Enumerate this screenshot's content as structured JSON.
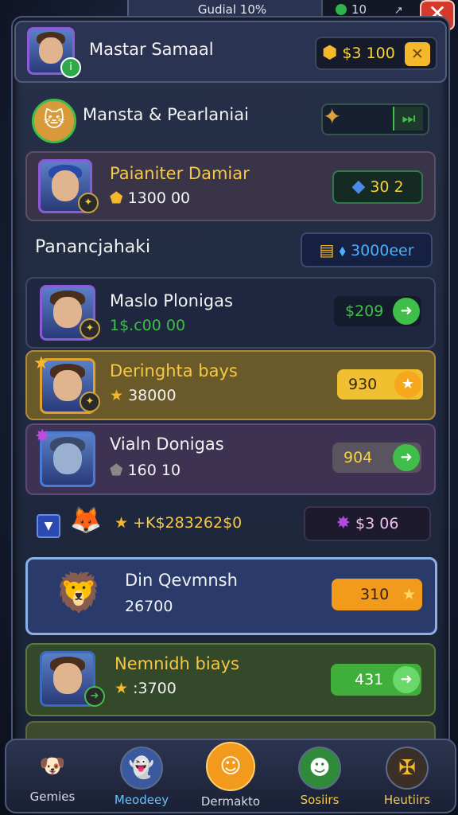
{
  "topbar": {
    "title": "Gudial 10%",
    "count": "10"
  },
  "profile": {
    "name": "Mastar Samaal",
    "currency": "$3 100"
  },
  "header": {
    "title": "Mansta & Pearlaniai"
  },
  "featured": {
    "name": "Paianiter Damiar",
    "value": "1300 00",
    "price": "30 2"
  },
  "section": {
    "title": "Panancjahaki",
    "value": "3000eer"
  },
  "rows": [
    {
      "name": "Maslo Plonigas",
      "value": "1$.c00 00",
      "price": "$209"
    },
    {
      "name": "Deringhta bays",
      "value": "38000",
      "price": "930"
    },
    {
      "name": "Vialn Donigas",
      "value": "160 10",
      "price": "904"
    }
  ],
  "sort_row": {
    "value": "+K$283262$0",
    "price": "$3 06"
  },
  "selected": {
    "name": "Din Qevmnsh",
    "value": "26700",
    "price": "310"
  },
  "last": {
    "name": "Nemnidh biays",
    "value": ":3700",
    "price": "431"
  },
  "nav": [
    {
      "label": "Gemies"
    },
    {
      "label": "Meodeey"
    },
    {
      "label": "Dermakto"
    },
    {
      "label": "Sosiirs"
    },
    {
      "label": "Heutiirs"
    }
  ],
  "colors": {
    "accent_gold": "#f5b82a",
    "accent_green": "#3fbf4a",
    "accent_orange": "#f29a1c"
  }
}
